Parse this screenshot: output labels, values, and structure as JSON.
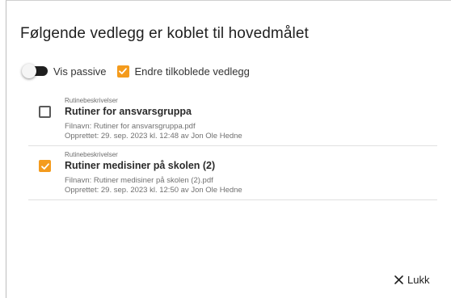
{
  "dialog": {
    "title": "Følgende vedlegg er koblet til hovedmålet"
  },
  "controls": {
    "vis_passive": {
      "label": "Vis passive",
      "on": false
    },
    "endre": {
      "label": "Endre tilkoblede vedlegg",
      "checked": true
    }
  },
  "attachments": [
    {
      "category": "Rutinebeskrivelser",
      "name": "Rutiner for ansvarsgruppa",
      "filename": "Filnavn: Rutiner for ansvarsgruppa.pdf",
      "created": "Opprettet: 29. sep. 2023 kl. 12:48 av Jon Ole Hedne",
      "checked": false
    },
    {
      "category": "Rutinebeskrivelser",
      "name": "Rutiner medisiner på skolen (2)",
      "filename": "Filnavn: Rutiner medisiner på skolen (2).pdf",
      "created": "Opprettet: 29. sep. 2023 kl. 12:50 av Jon Ole Hedne",
      "checked": true
    }
  ],
  "footer": {
    "close_label": "Lukk",
    "close_icon": "close-icon"
  },
  "colors": {
    "accent": "#f49b1d",
    "toggle_track": "#1f1f1f"
  }
}
